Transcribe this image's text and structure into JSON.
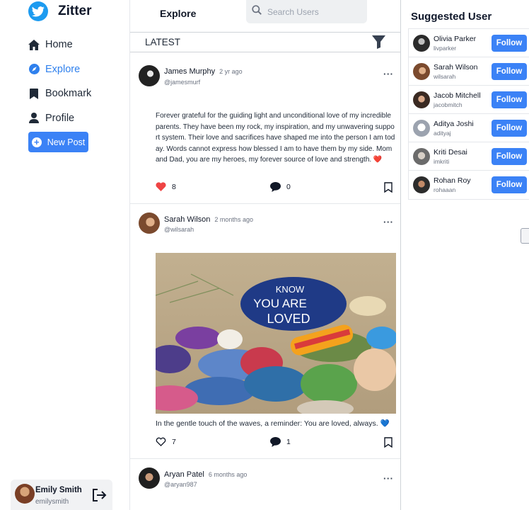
{
  "app": {
    "name": "Zitter"
  },
  "nav": {
    "items": [
      {
        "label": "Home",
        "icon": "home-icon",
        "active": false
      },
      {
        "label": "Explore",
        "icon": "compass-icon",
        "active": true
      },
      {
        "label": "Bookmark",
        "icon": "bookmark-icon",
        "active": false
      },
      {
        "label": "Profile",
        "icon": "user-icon",
        "active": false
      }
    ],
    "new_post_label": "New Post"
  },
  "current_user": {
    "name": "Emily Smith",
    "handle": "emilysmith"
  },
  "feed": {
    "tab_label": "Explore",
    "search_placeholder": "Search Users",
    "section_label": "LATEST",
    "posts": [
      {
        "author": "James Murphy",
        "handle": "@jamesmurf",
        "time": "2 yr ago",
        "text": "Forever grateful for the guiding light and unconditional love of my incredible parents. They have been my rock, my inspiration, and my unwavering support system. Their love and sacrifices have shaped me into the person I am today. Words cannot express how blessed I am to have them by my side. Mom and Dad, you are my heroes, my forever source of love and strength. ❤️",
        "likes": "8",
        "comments": "0",
        "liked": true
      },
      {
        "author": "Sarah Wilson",
        "handle": "@wilsarah",
        "time": "2 months ago",
        "text": "In the gentle touch of the waves, a reminder: You are loved, always. 💙",
        "image_text": [
          "KNOW",
          "YOU ARE",
          "LOVED"
        ],
        "likes": "7",
        "comments": "1",
        "liked": false
      },
      {
        "author": "Aryan Patel",
        "handle": "@aryan987",
        "time": "6 months ago"
      }
    ]
  },
  "suggested": {
    "title": "Suggested User",
    "follow_label": "Follow",
    "users": [
      {
        "name": "Olivia Parker",
        "handle": "livparker"
      },
      {
        "name": "Sarah Wilson",
        "handle": "wilsarah"
      },
      {
        "name": "Jacob Mitchell",
        "handle": "jacobmitch"
      },
      {
        "name": "Aditya Joshi",
        "handle": "adityaj"
      },
      {
        "name": "Kriti Desai",
        "handle": "imkriti"
      },
      {
        "name": "Rohan Roy",
        "handle": "rohaaan"
      }
    ]
  },
  "colors": {
    "accent": "#3b82f6",
    "brand": "#1d9bf0",
    "active_nav": "#2f80ed",
    "like": "#ef4444"
  }
}
